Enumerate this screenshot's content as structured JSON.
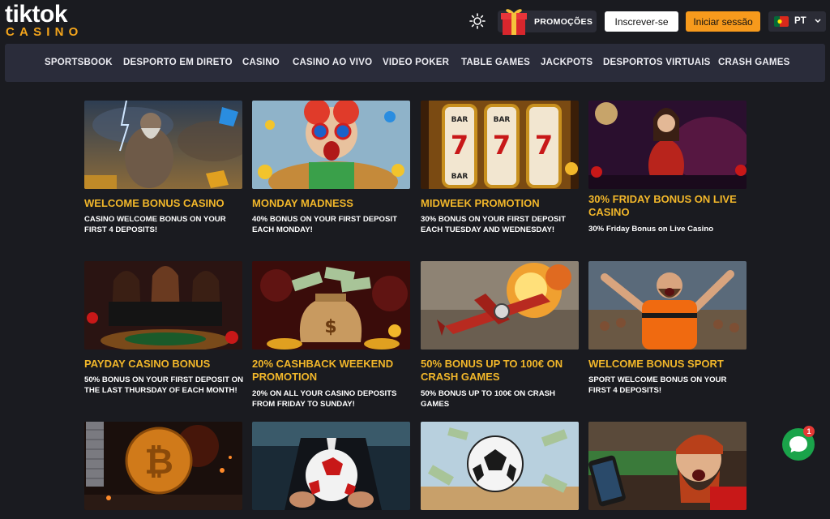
{
  "brand": {
    "top": "tiktok",
    "bottom": "CASINO"
  },
  "header": {
    "promo_label": "PROMOÇÕES",
    "signup_label": "Inscrever-se",
    "login_label": "Iniciar sessão",
    "language": "PT"
  },
  "nav": {
    "items": [
      {
        "label": "SPORTSBOOK"
      },
      {
        "label": "DESPORTO EM DIRETO"
      },
      {
        "label": "CASINO"
      },
      {
        "label": "CASINO AO VIVO"
      },
      {
        "label": "VIDEO POKER"
      },
      {
        "label": "TABLE GAMES"
      },
      {
        "label": "JACKPOTS"
      },
      {
        "label": "DESPORTOS VIRTUAIS"
      },
      {
        "label": "CRASH GAMES"
      }
    ]
  },
  "promotions": [
    {
      "title": "WELCOME BONUS CASINO",
      "desc": "CASINO WELCOME BONUS ON YOUR FIRST 4 DEPOSITS!"
    },
    {
      "title": "MONDAY MADNESS",
      "desc": "40% BONUS ON YOUR FIRST DEPOSIT EACH MONDAY!"
    },
    {
      "title": "MIDWEEK PROMOTION",
      "desc": "30% BONUS ON YOUR FIRST DEPOSIT EACH TUESDAY AND WEDNESDAY!"
    },
    {
      "title": "30% FRIDAY BONUS ON LIVE CASINO",
      "desc": "30% Friday Bonus on Live Casino"
    },
    {
      "title": "PAYDAY CASINO BONUS",
      "desc": "50% BONUS ON YOUR FIRST DEPOSIT ON THE LAST THURSDAY OF EACH MONTH!"
    },
    {
      "title": "20% CASHBACK WEEKEND PROMOTION",
      "desc": "20% ON ALL YOUR CASINO DEPOSITS FROM FRIDAY TO SUNDAY!"
    },
    {
      "title": "50% BONUS UP TO 100€ ON CRASH GAMES",
      "desc": "50% BONUS UP TO 100€ ON CRASH GAMES"
    },
    {
      "title": "WELCOME BONUS SPORT",
      "desc": "SPORT WELCOME BONUS ON YOUR FIRST 4 DEPOSITS!"
    }
  ],
  "chat": {
    "badge": "1"
  },
  "colors": {
    "accent": "#f79a1c",
    "title": "#f2b72a",
    "background": "#1a1b20",
    "nav": "#2a2c3a",
    "chat": "#1aa34a"
  }
}
